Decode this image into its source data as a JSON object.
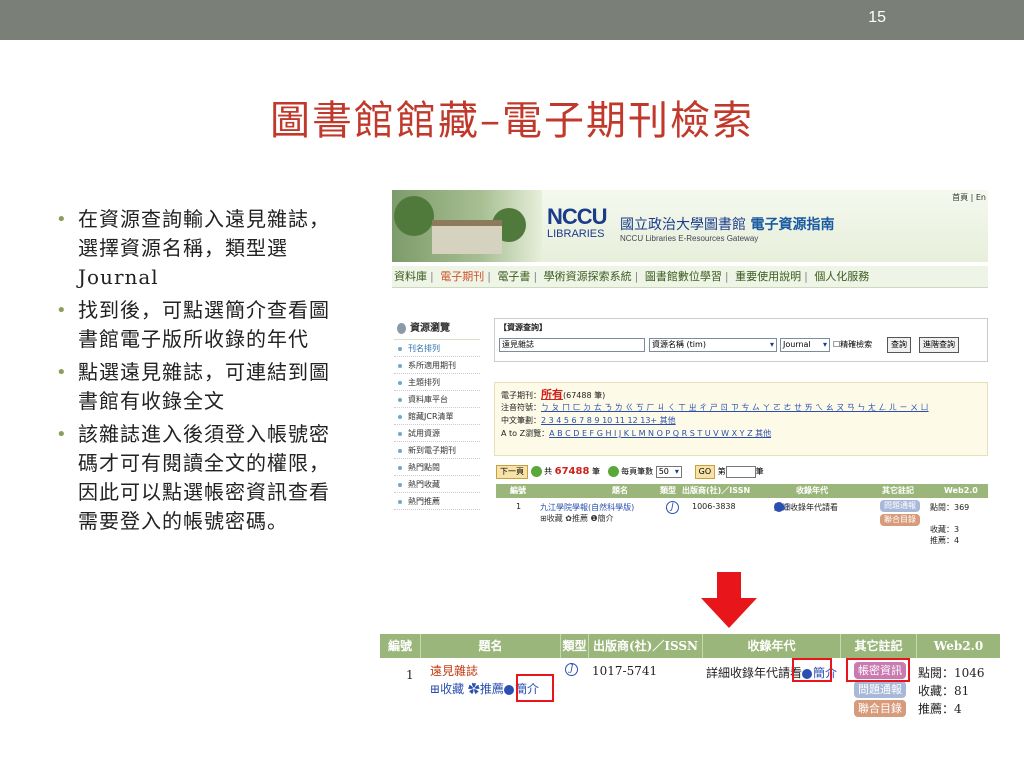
{
  "slide": {
    "page_number": "15",
    "title": "圖書館館藏–電子期刊檢索",
    "bullets": [
      "在資源查詢輸入遠見雜誌，選擇資源名稱，類型選Journal",
      "找到後，可點選簡介查看圖書館電子版所收錄的年代",
      "點選遠見雜誌，可連結到圖書館有收錄全文",
      "該雜誌進入後須登入帳號密碼才可有閱讀全文的權限，因此可以點選帳密資訊查看需要登入的帳號密碼。"
    ]
  },
  "site": {
    "logo_top": "NCCU",
    "logo_bottom": "LIBRARIES",
    "title_plain": "國立政治大學圖書館",
    "title_bold": "電子資源指南",
    "subtitle": "NCCU Libraries E-Resources Gateway",
    "top_link": "首頁 | En",
    "nav": [
      "資料庫",
      "電子期刊",
      "電子書",
      "學術資源探索系統",
      "圖書館數位學習",
      "重要使用說明",
      "個人化服務"
    ]
  },
  "sidebar": {
    "heading": "資源瀏覽",
    "items": [
      "刊名排列",
      "系所適用期刊",
      "主題排列",
      "資料庫平台",
      "館藏JCR清單",
      "試用資源",
      "新到電子期刊",
      "熱門點閱",
      "熱門收藏",
      "熱門推薦"
    ]
  },
  "search": {
    "label": "【資源查詢】",
    "query": "遠見雜誌",
    "field": "資源名稱 (tim)",
    "type": "Journal",
    "checkbox_label": "精確檢索",
    "search_button": "查詢",
    "advanced_button": "進階查詢"
  },
  "browse": {
    "ejournal_label": "電子期刊：",
    "ejournal_all": "所有",
    "ejournal_count": "(67488 筆)",
    "zhuyin_label": "注音符號：",
    "zhuyin": "ㄅ ㄆ ㄇ ㄈ ㄉ ㄊ ㄋ ㄌ ㄍ ㄎ ㄏ ㄐ ㄑ ㄒ ㄓ ㄔ ㄕ ㄖ ㄗ ㄘ ㄙ ㄚ ㄛ ㄜ ㄝ ㄞ ㄟ ㄠ ㄡ ㄢ ㄣ ㄤ ㄥ ㄦ ㄧ ㄨ ㄩ",
    "stroke_label": "中文筆劃：",
    "strokes": "2 3 4 5 6 7 8 9 10 11 12 13+ 其他",
    "az_label": "A to Z瀏覽：",
    "az": "A B C D E F G H I J K L M N O P Q R S T U V W X Y Z 其他"
  },
  "pager": {
    "next": "下一頁",
    "total_prefix": "共",
    "total": "67488",
    "total_suffix": "筆",
    "per_page_label": "每頁筆數",
    "per_page": "50",
    "go": "GO",
    "page_prefix": "第",
    "page_suffix": "筆"
  },
  "table1": {
    "headers": [
      "編號",
      "題名",
      "類型",
      "出版商(社)／ISSN",
      "收錄年代",
      "其它註記",
      "Web2.0"
    ],
    "row": {
      "no": "1",
      "title": "九江學院學報(自然科學版)",
      "actions": "⊞收藏 ✿推薦 ❶簡介",
      "type": "J",
      "issn": "1006-3838",
      "coverage": "詳細收錄年代請看",
      "coverage_link": "簡介",
      "tag1": "問題通報",
      "tag2": "聯合目錄",
      "web_clicks": "點閱：369",
      "web_fav": "收藏：3",
      "web_rec": "推薦：4"
    }
  },
  "table2": {
    "headers": [
      "編號",
      "題名",
      "類型",
      "出版商(社)／ISSN",
      "收錄年代",
      "其它註記",
      "Web2.0"
    ],
    "row": {
      "no": "1",
      "title": "遠見雜誌",
      "fav": "收藏",
      "rec": "推薦",
      "intro": "簡介",
      "type": "J",
      "issn": "1017-5741",
      "coverage": "詳細收錄年代請看",
      "coverage_link": "簡介",
      "tag_account": "帳密資訊",
      "tag_report": "問題通報",
      "tag_union": "聯合目錄",
      "web_clicks": "點閱：1046",
      "web_fav": "收藏：81",
      "web_rec": "推薦：4"
    }
  },
  "colors": {
    "title": "#c0392b",
    "topbar": "#7a7f78",
    "table_header": "#9bb67a",
    "arrow": "#e8151b",
    "tag_account": "#c97ab0",
    "tag_report": "#a8b8d8",
    "tag_union": "#d79a7a"
  }
}
